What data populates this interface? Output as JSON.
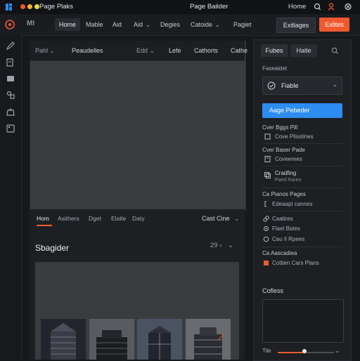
{
  "titlebar": {
    "app_name": "Page Plaks",
    "title": "Page Bailder",
    "home": "Home"
  },
  "toolbar": {
    "logo_text": "MI",
    "tabs": [
      "Home",
      "Mable",
      "Aid",
      "Aid",
      "Degies",
      "Catoide",
      "Pagiet"
    ],
    "settings_button": "Exitlages",
    "primary_button": "Exlites",
    "accent": "#ee5a2e"
  },
  "canvas": {
    "tabs": [
      "Pahl",
      "Peaudelles",
      "Edd",
      "Lefe",
      "Cathorts",
      "Cathe"
    ]
  },
  "bottom_panel": {
    "tabs": [
      "Hom",
      "Asithers",
      "Dget",
      "Elatle",
      "Daty"
    ],
    "sort_label": "Cast Cine",
    "section_title": "Sbagider",
    "page_indicator": "29 ‹"
  },
  "right_panel": {
    "tabs": [
      "Fubes",
      "Hatle"
    ],
    "section_label": "Faseaidet",
    "dropdown_value": "Fiable",
    "action_button": "Aage Pebeder",
    "action_color": "#2d8cf0",
    "groups": [
      {
        "label": "Cver Bggs Pill",
        "items": [
          "Cove Plisstines"
        ]
      },
      {
        "label": "Cver Baser Pade",
        "items": [
          "Coveerees"
        ]
      },
      {
        "label": "Cradfing",
        "sub": "Paed Raren"
      },
      {
        "label": "Ca Pianos Pages",
        "items": [
          "Edeaapl cannes"
        ]
      },
      {
        "label": "",
        "items": [
          "Caatires",
          "Flael Bates",
          "Cau Il Rpees"
        ]
      },
      {
        "label": "Ca Aascadiea",
        "items": [
          "Cottien Cars Plans"
        ]
      }
    ],
    "comments_label": "Cofless",
    "slider_label": "Tile",
    "slider_value": 0.48
  }
}
